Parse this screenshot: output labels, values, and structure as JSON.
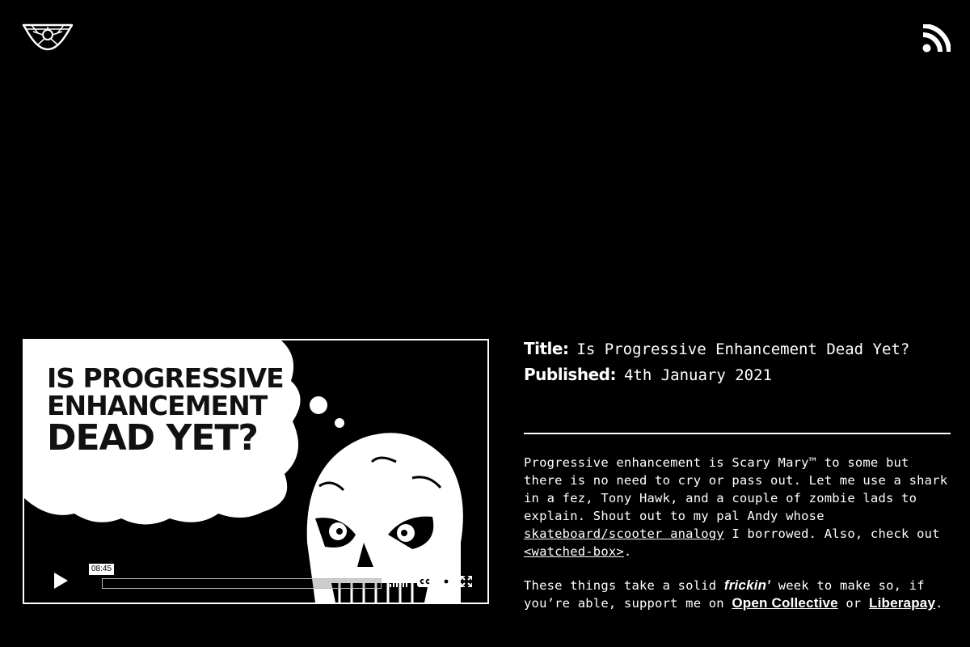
{
  "header": {
    "logo_icon": "skull-pants-logo-icon",
    "rss_icon": "rss-feed-icon"
  },
  "video": {
    "poster_line1": "IS PROGRESSIVE",
    "poster_line2": "ENHANCEMENT",
    "poster_line3": "DEAD YET?",
    "time_tooltip": "08:45",
    "progress": 0.0,
    "icons": [
      "play-icon",
      "volume-icon",
      "closed-captions-icon",
      "settings-gear-icon",
      "fullscreen-icon"
    ]
  },
  "meta": {
    "title_label": "Title:",
    "title_value": "Is Progressive Enhancement Dead Yet?",
    "published_label": "Published:",
    "published_value": "4th January 2021"
  },
  "description": {
    "p1_part1": "Progressive enhancement is Scary Mary™ to some but there is no need to cry or pass out. Let me use a shark in a fez, Tony Hawk, and a couple of zombie lads to explain. Shout out to my pal Andy whose ",
    "p1_link1": "skateboard/scooter analogy",
    "p1_part2": " I borrowed. Also, check out ",
    "p1_link2": "<watched-box>",
    "p1_part3": ".",
    "p2_part1": "These things take a solid ",
    "p2_em": "frickin’",
    "p2_part2": " week to make so, if you’re able, support me on ",
    "p2_link1": "Open Collective",
    "p2_part3": " or ",
    "p2_link2": "Liberapay",
    "p2_part4": "."
  },
  "colors": {
    "background": "#000000",
    "foreground": "#ffffff"
  }
}
